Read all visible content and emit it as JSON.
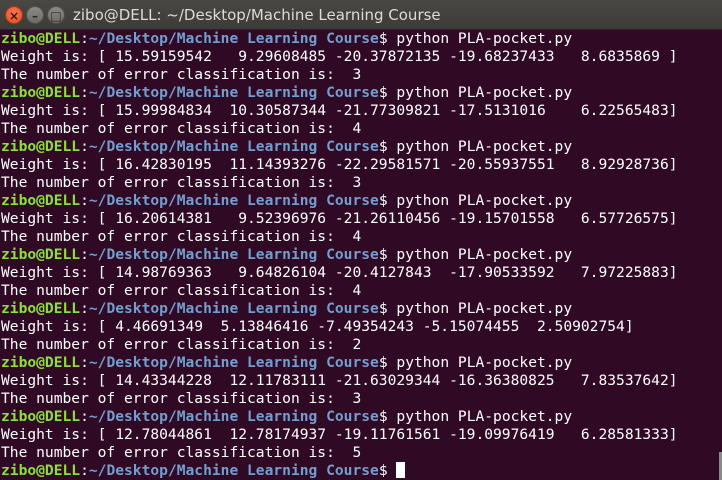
{
  "window": {
    "title": "zibo@DELL: ~/Desktop/Machine Learning Course",
    "close_glyph": "×",
    "minimize_glyph": "–",
    "maximize_glyph": "□"
  },
  "terminal": {
    "user_host": "zibo@DELL",
    "colon": ":",
    "path": "~/Desktop/Machine Learning Course",
    "prompt_symbol": "$ ",
    "runs": [
      {
        "command": "python PLA-pocket.py",
        "weight_line": "Weight is: [ 15.59159542   9.29608485 -20.37872135 -19.68237433   8.6835869 ]",
        "error_line": "The number of error classification is:  3"
      },
      {
        "command": "python PLA-pocket.py",
        "weight_line": "Weight is: [ 15.99984834  10.30587344 -21.77309821 -17.5131016    6.22565483]",
        "error_line": "The number of error classification is:  4"
      },
      {
        "command": "python PLA-pocket.py",
        "weight_line": "Weight is: [ 16.42830195  11.14393276 -22.29581571 -20.55937551   8.92928736]",
        "error_line": "The number of error classification is:  3"
      },
      {
        "command": "python PLA-pocket.py",
        "weight_line": "Weight is: [ 16.20614381   9.52396976 -21.26110456 -19.15701558   6.57726575]",
        "error_line": "The number of error classification is:  4"
      },
      {
        "command": "python PLA-pocket.py",
        "weight_line": "Weight is: [ 14.98769363   9.64826104 -20.4127843  -17.90533592   7.97225883]",
        "error_line": "The number of error classification is:  4"
      },
      {
        "command": "python PLA-pocket.py",
        "weight_line": "Weight is: [ 4.46691349  5.13846416 -7.49354243 -5.15074455  2.50902754]",
        "error_line": "The number of error classification is:  2"
      },
      {
        "command": "python PLA-pocket.py",
        "weight_line": "Weight is: [ 14.43344228  12.11783111 -21.63029344 -16.36380825   7.83537642]",
        "error_line": "The number of error classification is:  3"
      },
      {
        "command": "python PLA-pocket.py",
        "weight_line": "Weight is: [ 12.78044861  12.78174937 -19.11761561 -19.09976419   6.28581333]",
        "error_line": "The number of error classification is:  5"
      }
    ]
  },
  "colors": {
    "background": "#300a24",
    "user_host": "#8ae234",
    "path": "#729fcf",
    "text": "#ffffff"
  }
}
